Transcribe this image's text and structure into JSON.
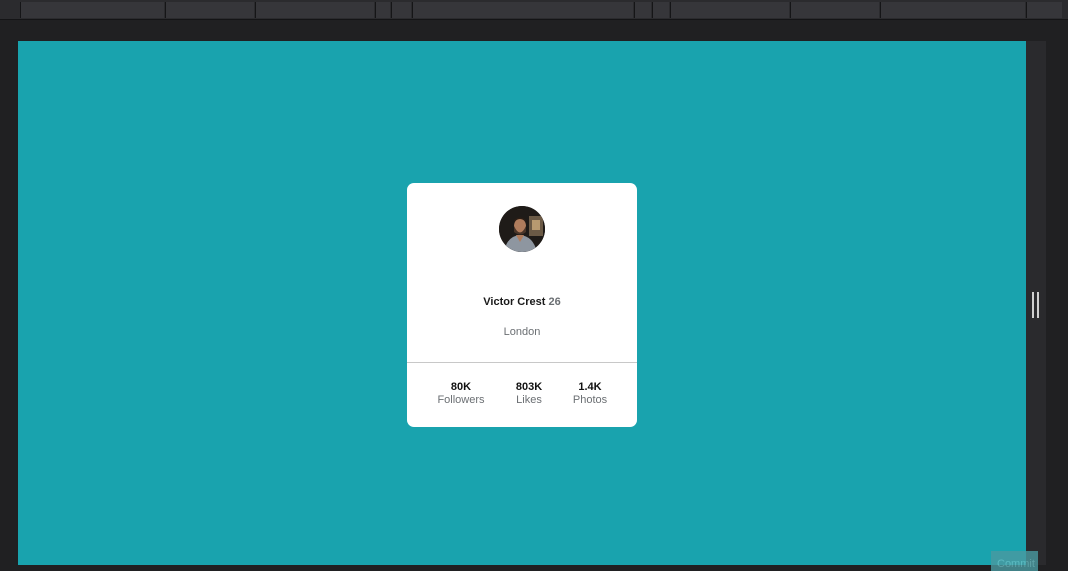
{
  "profile": {
    "name": "Victor Crest",
    "age": "26",
    "city": "London",
    "stats": [
      {
        "value": "80K",
        "label": "Followers"
      },
      {
        "value": "803K",
        "label": "Likes"
      },
      {
        "value": "1.4K",
        "label": "Photos"
      }
    ]
  },
  "ghost_button": "Commit",
  "colors": {
    "preview_bg": "#19a3ae",
    "card_bg": "#ffffff",
    "editor_bg": "#202022"
  }
}
